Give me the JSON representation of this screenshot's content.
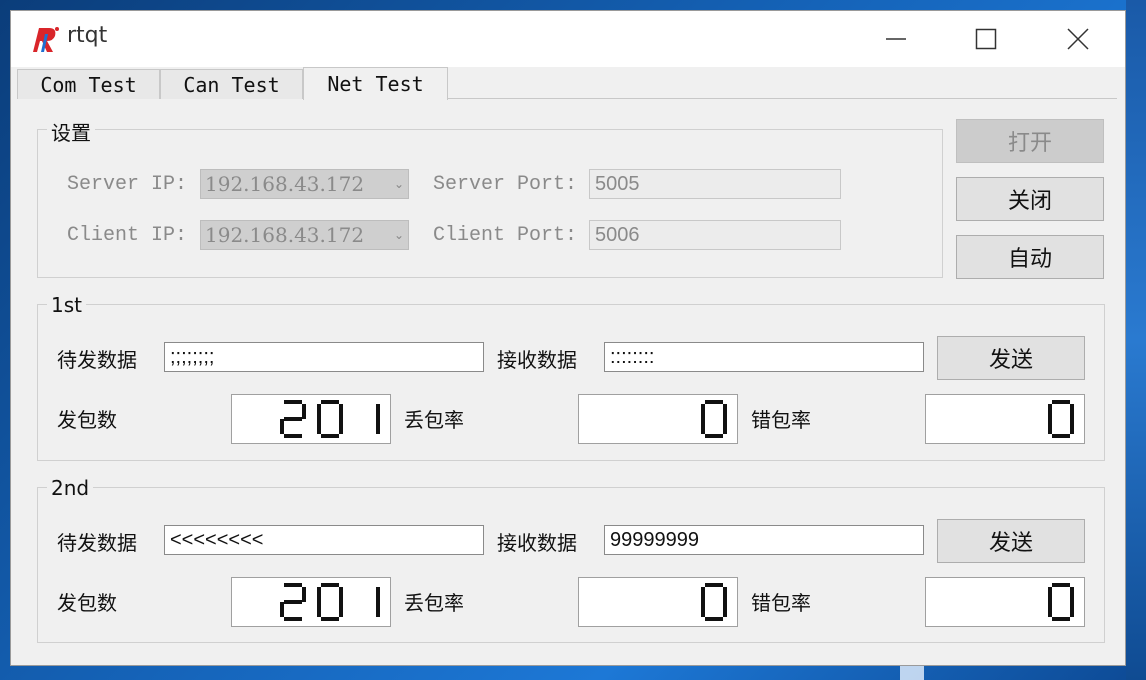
{
  "window": {
    "title": "rtqt",
    "controls": [
      "minimize-icon",
      "maximize-icon",
      "close-icon"
    ]
  },
  "tabs": [
    {
      "label": "Com Test",
      "active": false
    },
    {
      "label": "Can Test",
      "active": false
    },
    {
      "label": "Net Test",
      "active": true
    }
  ],
  "settings": {
    "title": "设置",
    "server_ip_label": "Server IP:",
    "server_ip_value": "192.168.43.172",
    "server_port_label": "Server Port:",
    "server_port_value": "5005",
    "client_ip_label": "Client IP:",
    "client_ip_value": "192.168.43.172",
    "client_port_label": "Client Port:",
    "client_port_value": "5006"
  },
  "side_buttons": {
    "open": "打开",
    "close": "关闭",
    "auto": "自动"
  },
  "group1": {
    "title": "1st",
    "send_label": "待发数据",
    "send_value": ";;;;;;;;",
    "recv_label": "接收数据",
    "recv_value": "::::::::",
    "send_button": "发送",
    "packets_label": "发包数",
    "packets_value": "201",
    "loss_label": "丢包率",
    "loss_value": "0",
    "error_label": "错包率",
    "error_value": "0"
  },
  "group2": {
    "title": "2nd",
    "send_label": "待发数据",
    "send_value": "<<<<<<<<",
    "recv_label": "接收数据",
    "recv_value": "99999999",
    "send_button": "发送",
    "packets_label": "发包数",
    "packets_value": "201",
    "loss_label": "丢包率",
    "loss_value": "0",
    "error_label": "错包率",
    "error_value": "0"
  },
  "colors": {
    "window_bg": "#f0f0f0",
    "disabled_text": "#8a8a8a",
    "logo_red": "#d9252a",
    "logo_blue": "#1f6fd1"
  }
}
